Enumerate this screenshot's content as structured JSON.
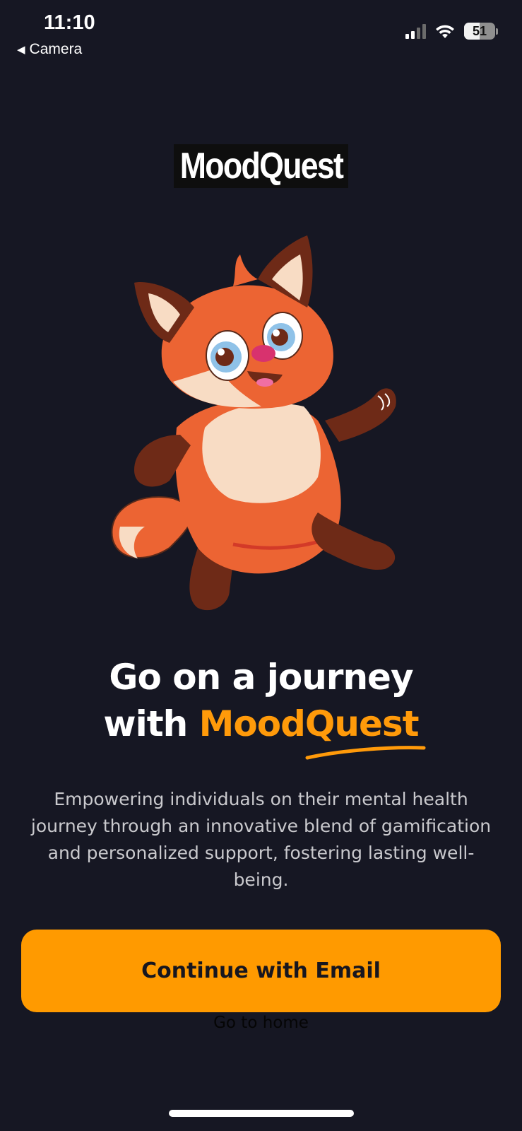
{
  "status_bar": {
    "time": "11:10",
    "back_label": "Camera",
    "battery": "51"
  },
  "logo_text": "MoodQuest",
  "headline": {
    "line1": "Go on a journey",
    "line2_prefix": "with ",
    "brand": "MoodQuest"
  },
  "description": "Empowering individuals on their mental health journey through an innovative blend of gamification and personalized support, fostering lasting well-being.",
  "cta_label": "Continue with Email",
  "secondary_link": "Go to home",
  "colors": {
    "background": "#161723",
    "accent": "#ff9a00",
    "text": "#ffffff"
  }
}
